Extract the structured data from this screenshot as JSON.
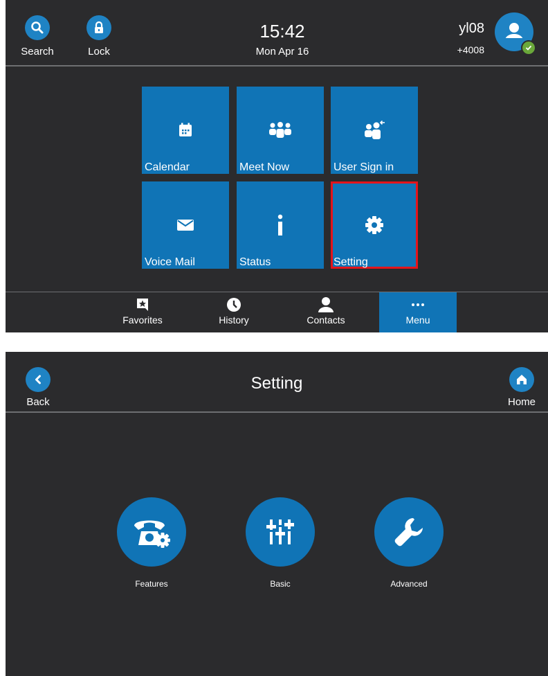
{
  "menu_screen": {
    "top_bar": {
      "search_label": "Search",
      "lock_label": "Lock",
      "time": "15:42",
      "date": "Mon Apr 16",
      "user_name": "yl08",
      "user_extension": "+4008",
      "presence_status": "available"
    },
    "tiles": [
      {
        "label": "Calendar",
        "icon": "calendar-icon"
      },
      {
        "label": "Meet Now",
        "icon": "group-icon"
      },
      {
        "label": "User Sign in",
        "icon": "user-sign-in-icon"
      },
      {
        "label": "Voice Mail",
        "icon": "envelope-icon"
      },
      {
        "label": "Status",
        "icon": "info-icon"
      },
      {
        "label": "Setting",
        "icon": "gear-icon",
        "selected": true
      }
    ],
    "nav": [
      {
        "label": "Favorites",
        "icon": "star-bookmark-icon"
      },
      {
        "label": "History",
        "icon": "clock-icon"
      },
      {
        "label": "Contacts",
        "icon": "person-icon"
      },
      {
        "label": "Menu",
        "icon": "more-dots-icon",
        "active": true
      }
    ]
  },
  "setting_screen": {
    "back_label": "Back",
    "title": "Setting",
    "home_label": "Home",
    "options": [
      {
        "label": "Features",
        "icon": "phone-gear-icon"
      },
      {
        "label": "Basic",
        "icon": "sliders-icon"
      },
      {
        "label": "Advanced",
        "icon": "wrench-icon"
      }
    ]
  },
  "colors": {
    "screen_bg": "#2b2b2d",
    "accent_blue": "#1074b6",
    "icon_blue": "#1f83c4",
    "selection_red": "#e4141c",
    "presence_green": "#6aa83a"
  }
}
